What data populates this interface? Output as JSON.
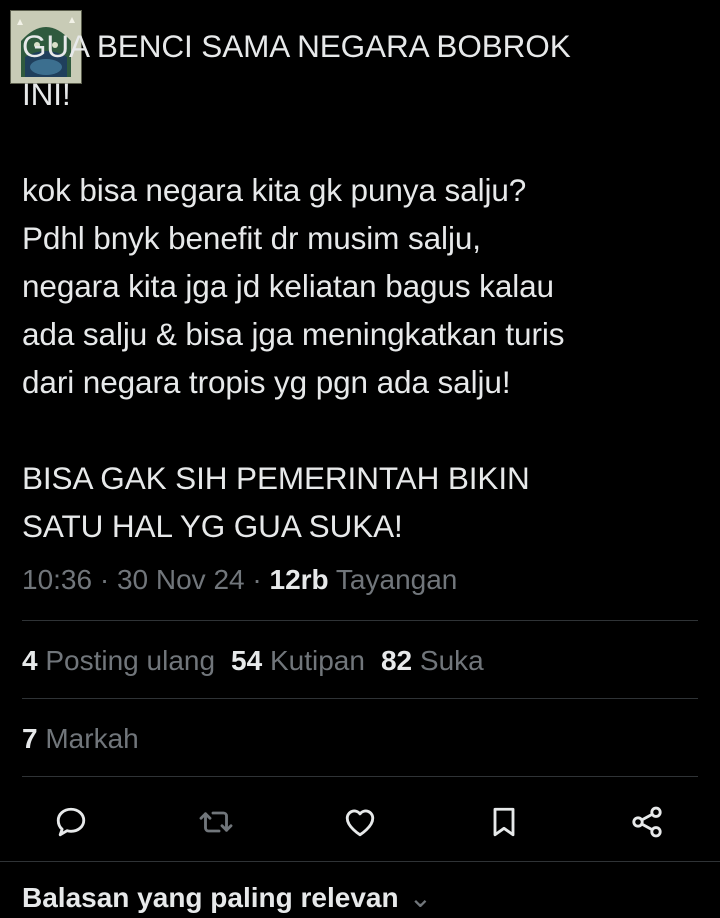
{
  "tweet": {
    "text": "GUA BENCI SAMA NEGARA BOBROK\nINI!\n\nkok bisa negara kita gk punya salju?\nPdhl bnyk benefit dr musim salju,\nnegara kita jga jd keliatan bagus kalau\nada salju & bisa jga meningkatkan turis\ndari negara tropis yg pgn ada salju!\n\nBISA GAK SIH PEMERINTAH BIKIN\nSATU HAL YG GUA SUKA!",
    "time": "10:36",
    "sep1": " · ",
    "date": "30 Nov 24",
    "sep2": " · ",
    "views_count": "12rb",
    "views_label": " Tayangan"
  },
  "stats": {
    "reposts_count": "4",
    "reposts_label": " Posting ulang",
    "quotes_count": "54",
    "quotes_label": " Kutipan",
    "likes_count": "82",
    "likes_label": " Suka",
    "bookmarks_count": "7",
    "bookmarks_label": " Markah"
  },
  "actions": {
    "icons": [
      "reply-icon",
      "repost-icon",
      "like-icon",
      "bookmark-icon",
      "share-icon"
    ],
    "icon_color": "#71767b"
  },
  "replies": {
    "sort_label": "Balasan yang paling relevan",
    "chevron": "⌄"
  },
  "colors": {
    "background": "#000000",
    "text": "#e7e9ea",
    "muted": "#71767b",
    "divider": "#2f3336"
  }
}
